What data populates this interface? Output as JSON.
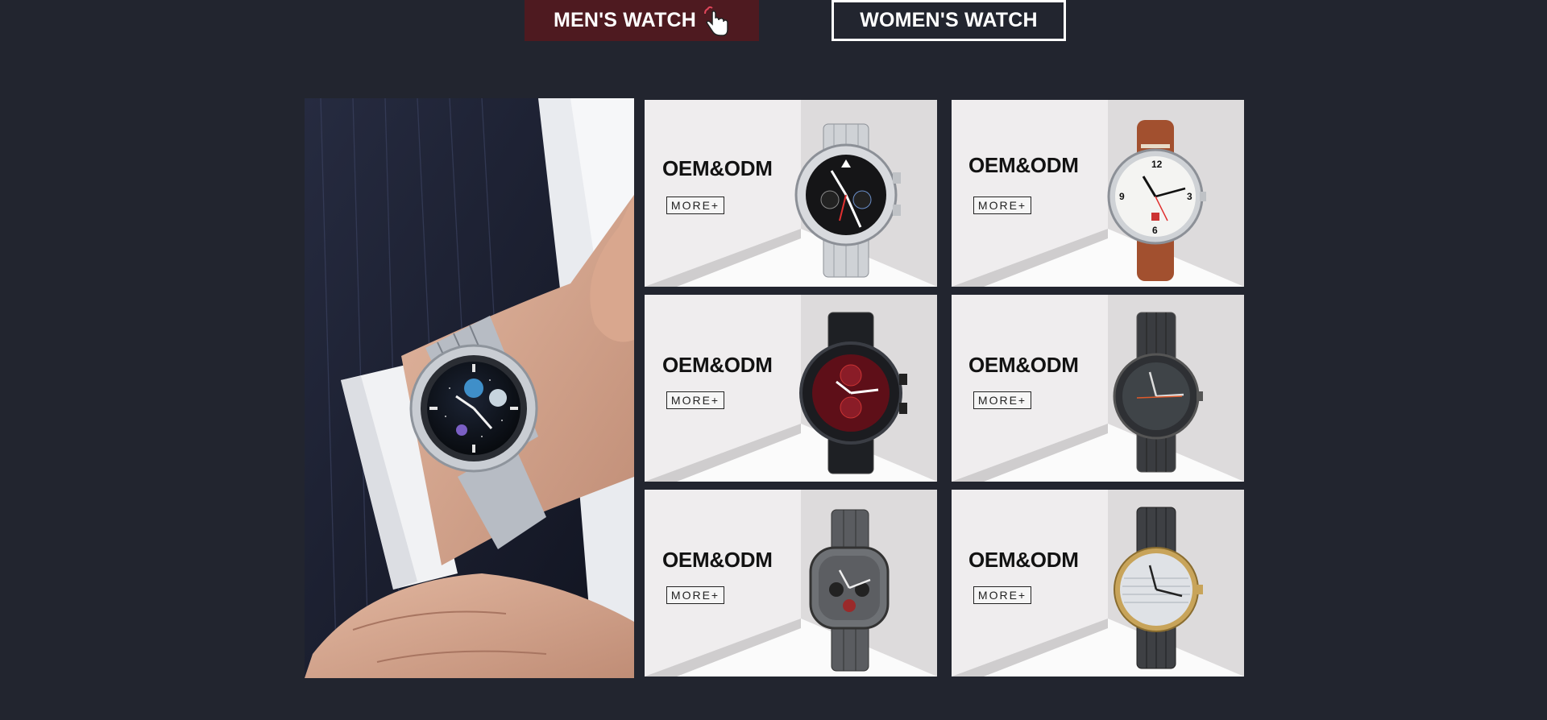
{
  "tabs": {
    "men": {
      "label": "MEN'S WATCH",
      "icon": "pointer-hand-icon",
      "active": true
    },
    "women": {
      "label": "WOMEN'S WATCH",
      "active": false
    }
  },
  "colors": {
    "page_bg": "#22252f",
    "active_tab_bg": "#4e1a20",
    "card_bg": "#efedee"
  },
  "products": [
    {
      "title": "OEM&ODM",
      "button": "MORE+",
      "watch": "silver chronograph with black dial"
    },
    {
      "title": "OEM&ODM",
      "button": "MORE+",
      "watch": "white pilot dial with brown leather strap"
    },
    {
      "title": "OEM&ODM",
      "button": "MORE+",
      "watch": "black steel chronograph with red dial"
    },
    {
      "title": "OEM&ODM",
      "button": "MORE+",
      "watch": "gunmetal steel with dark grey dial"
    },
    {
      "title": "OEM&ODM",
      "button": "MORE+",
      "watch": "gunmetal octagonal chronograph"
    },
    {
      "title": "OEM&ODM",
      "button": "MORE+",
      "watch": "dark steel with silver dial and gold bezel"
    }
  ]
}
